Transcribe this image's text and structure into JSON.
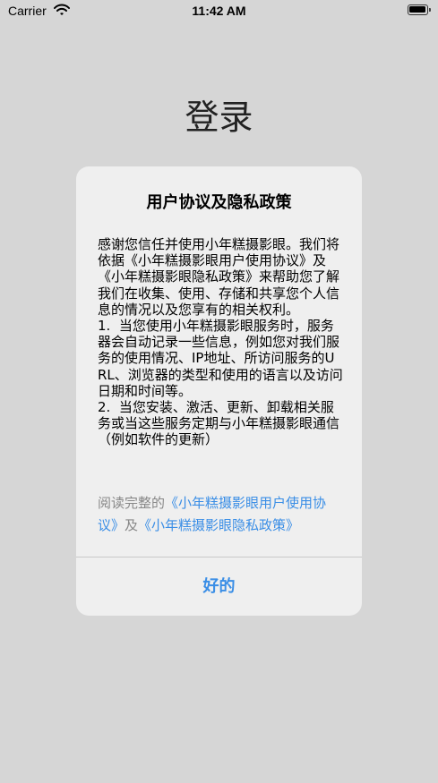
{
  "status_bar": {
    "carrier": "Carrier",
    "time": "11:42 AM"
  },
  "page": {
    "title": "登录"
  },
  "dialog": {
    "title": "用户协议及隐私政策",
    "body": [
      "感谢您信任并使用小年糕摄影眼。我们将依据《小年糕摄影眼用户使用协议》及《小年糕摄影眼隐私政策》来帮助您了解我们在收集、使用、存储和共享您个人信息的情况以及您享有的相关权利。",
      "1.  当您使用小年糕摄影眼服务时，服务器会自动记录一些信息，例如您对我们服务的使用情况、IP地址、所访问服务的URL、浏览器的类型和使用的语言以及访问日期和时间等。",
      "2.  当您安装、激活、更新、卸载相关服务或当这些服务定期与小年糕摄影眼通信（例如软件的更新）"
    ],
    "read_prefix": "阅读完整的",
    "user_agreement_link": "《小年糕摄影眼用户使用协议》",
    "conjunction": "及",
    "privacy_policy_link": "《小年糕摄影眼隐私政策》",
    "ok_label": "好的"
  },
  "colors": {
    "background": "#d6d6d6",
    "dialog": "#efefef",
    "link": "#3a8ee6"
  },
  "icons": {
    "wifi": "wifi-icon",
    "battery": "battery-icon"
  }
}
